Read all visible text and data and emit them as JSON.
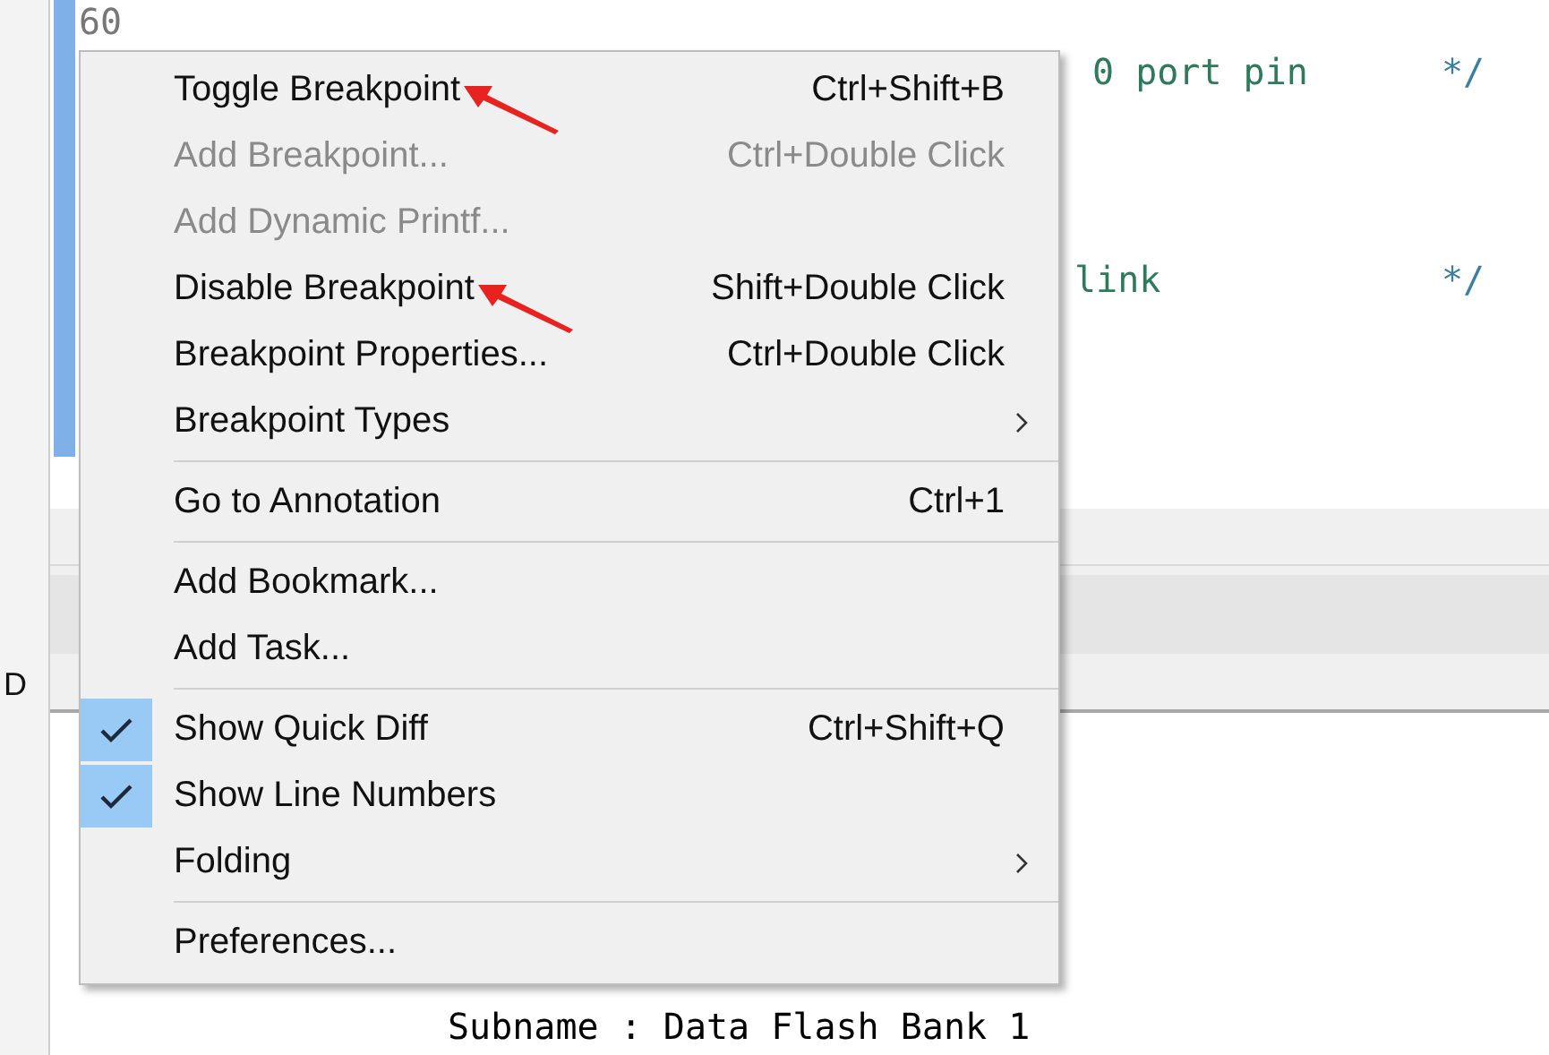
{
  "editor": {
    "line_number": "60",
    "code_lines": [
      {
        "text": "0 port pin",
        "comment_end": "*/"
      },
      {
        "text": "link",
        "comment_end": "*/"
      }
    ]
  },
  "side_panel": {
    "tab_label": "D"
  },
  "console": {
    "text": "Subname : Data Flash Bank 1"
  },
  "context_menu": {
    "items": [
      {
        "kind": "item",
        "label": "Toggle Breakpoint",
        "shortcut": "Ctrl+Shift+B",
        "disabled": false,
        "checked": false,
        "submenu": false,
        "annotated": true
      },
      {
        "kind": "item",
        "label": "Add Breakpoint...",
        "shortcut": "Ctrl+Double Click",
        "disabled": true,
        "checked": false,
        "submenu": false,
        "annotated": false
      },
      {
        "kind": "item",
        "label": "Add Dynamic Printf...",
        "disabled": true,
        "checked": false,
        "submenu": false,
        "annotated": false
      },
      {
        "kind": "item",
        "label": "Disable Breakpoint",
        "shortcut": "Shift+Double Click",
        "disabled": false,
        "checked": false,
        "submenu": false,
        "annotated": true
      },
      {
        "kind": "item",
        "label": "Breakpoint Properties...",
        "shortcut": "Ctrl+Double Click",
        "disabled": false,
        "checked": false,
        "submenu": false,
        "annotated": false
      },
      {
        "kind": "item",
        "label": "Breakpoint Types",
        "disabled": false,
        "checked": false,
        "submenu": true,
        "annotated": false
      },
      {
        "kind": "separator"
      },
      {
        "kind": "item",
        "label": "Go to Annotation",
        "shortcut": "Ctrl+1",
        "disabled": false,
        "checked": false,
        "submenu": false,
        "annotated": false
      },
      {
        "kind": "separator"
      },
      {
        "kind": "item",
        "label": "Add Bookmark...",
        "disabled": false,
        "checked": false,
        "submenu": false,
        "annotated": false
      },
      {
        "kind": "item",
        "label": "Add Task...",
        "disabled": false,
        "checked": false,
        "submenu": false,
        "annotated": false
      },
      {
        "kind": "separator"
      },
      {
        "kind": "item",
        "label": "Show Quick Diff",
        "shortcut": "Ctrl+Shift+Q",
        "disabled": false,
        "checked": true,
        "submenu": false,
        "annotated": false
      },
      {
        "kind": "item",
        "label": "Show Line Numbers",
        "disabled": false,
        "checked": true,
        "submenu": false,
        "annotated": false
      },
      {
        "kind": "item",
        "label": "Folding",
        "disabled": false,
        "checked": false,
        "submenu": true,
        "annotated": false
      },
      {
        "kind": "separator"
      },
      {
        "kind": "item",
        "label": "Preferences...",
        "disabled": false,
        "checked": false,
        "submenu": false,
        "annotated": false
      }
    ]
  }
}
